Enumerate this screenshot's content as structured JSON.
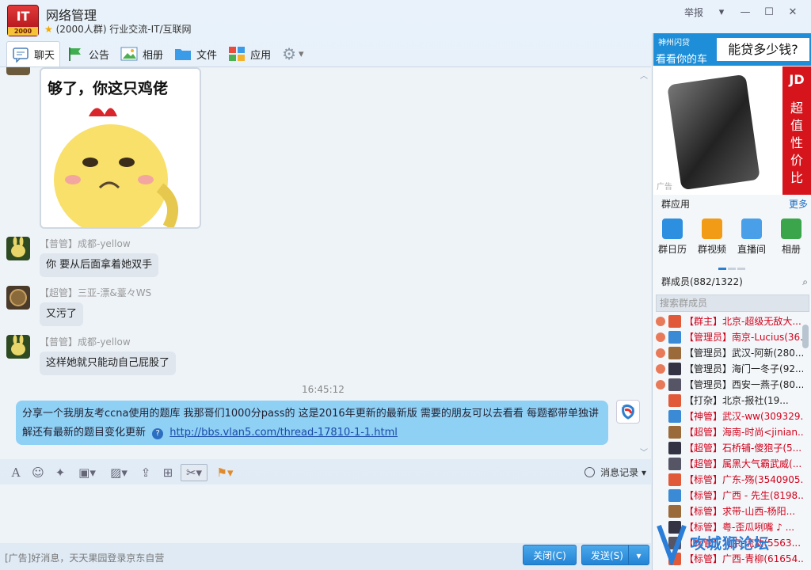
{
  "header": {
    "logo_text": "IT",
    "logo_sub": "2000",
    "title": "网络管理",
    "subtitle": "(2000人群) 行业交流-IT/互联网",
    "report": "举报"
  },
  "tabs": [
    {
      "label": "聊天",
      "icon": "chat-icon"
    },
    {
      "label": "公告",
      "icon": "announcement-icon"
    },
    {
      "label": "相册",
      "icon": "album-icon"
    },
    {
      "label": "文件",
      "icon": "folder-icon"
    },
    {
      "label": "应用",
      "icon": "apps-icon"
    }
  ],
  "messages": {
    "sticker_caption": "够了，你这只鸡佬",
    "m1_meta": "【普管】成都-yellow",
    "m1_text": "你 要从后面拿着她双手",
    "m2_meta": "【超管】三亚-漂&薹々WS",
    "m2_text": "又污了",
    "m3_meta": "【普管】成都-yellow",
    "m3_text": "这样她就只能动自己屁股了",
    "timestamp": "16:45:12",
    "my_text": "分享一个我朋友考ccna使用的题库 我那哥们1000分pass的 这是2016年更新的最新版 需要的朋友可以去看看 每题都带单独讲解还有最新的题目变化更新",
    "my_link": "http://bbs.vlan5.com/thread-17810-1-1.html"
  },
  "toolbar": {
    "history": "消息记录"
  },
  "footer": {
    "ad_text": "[广告]好消息，天天果园登录京东自营",
    "close_label": "关闭(C)",
    "send_label": "发送(S)"
  },
  "sidebar": {
    "ad_top_l1": "神州闪贷",
    "ad_top_l2": "看看你的车",
    "ad_top_r": "能贷多少钱?",
    "ad_jd": "JD",
    "ad_jd_text": "超值性价比",
    "ad_tag": "广告",
    "apps_title": "群应用",
    "apps_more": "更多",
    "apps": [
      {
        "label": "群日历",
        "color": "#2d8fe0"
      },
      {
        "label": "群视频",
        "color": "#f29b16"
      },
      {
        "label": "直播间",
        "color": "#e04b3b"
      },
      {
        "label": "相册",
        "color": "#3aa54a"
      }
    ],
    "members_title": "群成员(882/1322)",
    "search_placeholder": "搜索群成员",
    "members": [
      {
        "role": "【群主】",
        "name": "北京-超级无敌大...",
        "red": true
      },
      {
        "role": "【管理员】",
        "name": "南京-Lucius(36...",
        "red": true
      },
      {
        "role": "【管理员】",
        "name": "武汉-阿新(280...",
        "red": false
      },
      {
        "role": "【管理员】",
        "name": "海门一冬子(92...",
        "red": false
      },
      {
        "role": "【管理员】",
        "name": "西安一燕子(80...",
        "red": false
      },
      {
        "role": "【打杂】",
        "name": "北京-报社(19...",
        "red": false
      },
      {
        "role": "【神管】",
        "name": "武汉-ww(309329...",
        "red": true
      },
      {
        "role": "【超管】",
        "name": "海南-时尚<jinian...",
        "red": true
      },
      {
        "role": "【超管】",
        "name": "石桥铺-傻狍子(5...",
        "red": true
      },
      {
        "role": "【超管】",
        "name": "属黑大气霸武威(...",
        "red": true
      },
      {
        "role": "【标管】",
        "name": "广东-殇(3540905...",
        "red": true
      },
      {
        "role": "【标管】",
        "name": "广西 - 先生(8198...",
        "red": true
      },
      {
        "role": "【标管】",
        "name": "求带-山西-杨阳...",
        "red": true
      },
      {
        "role": "【标管】",
        "name": "粤-歪瓜咧嘴 ♪ ...",
        "red": true
      },
      {
        "role": "【标管】",
        "name": "北京-流动(5563...",
        "red": true
      },
      {
        "role": "【标管】",
        "name": "广西-青柳(61654...",
        "red": true
      }
    ],
    "watermark": "攻城狮论坛"
  }
}
